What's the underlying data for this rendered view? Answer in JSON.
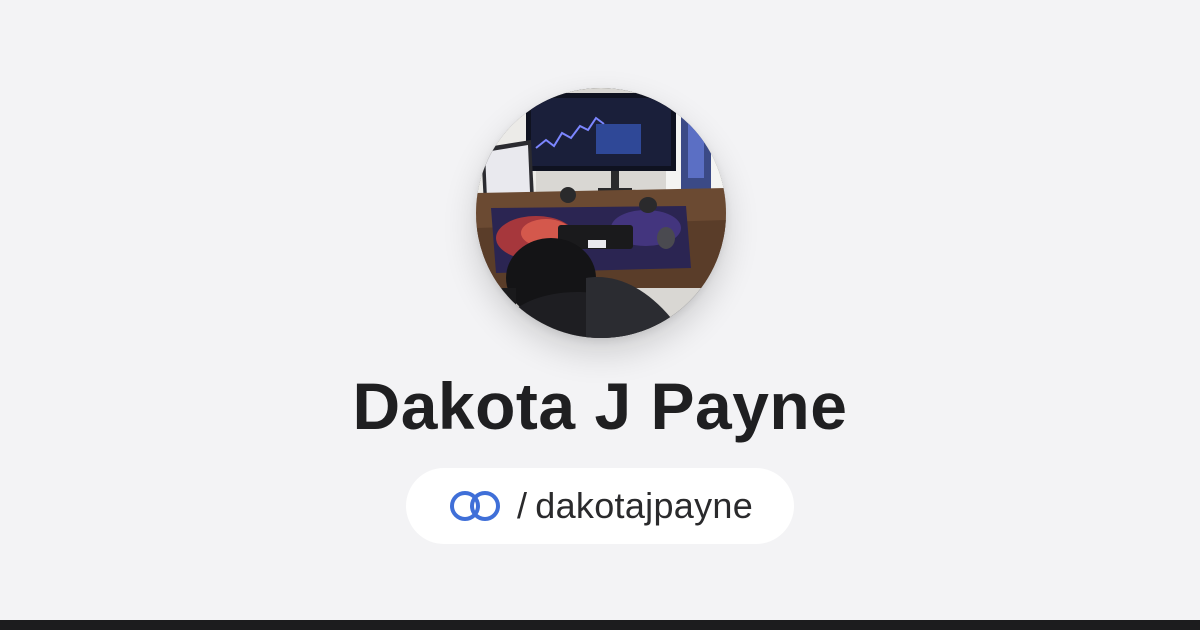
{
  "profile": {
    "name": "Dakota J Payne",
    "handle_separator": "/",
    "handle": "dakotajpayne",
    "avatar_icon": "profile-photo",
    "link_icon": "linked-rings-icon"
  },
  "colors": {
    "background": "#f3f3f5",
    "name_text": "#1f1f21",
    "pill_background": "#ffffff",
    "link_icon": "#3f6fd8",
    "bottom_bar": "#1c1c1e"
  }
}
